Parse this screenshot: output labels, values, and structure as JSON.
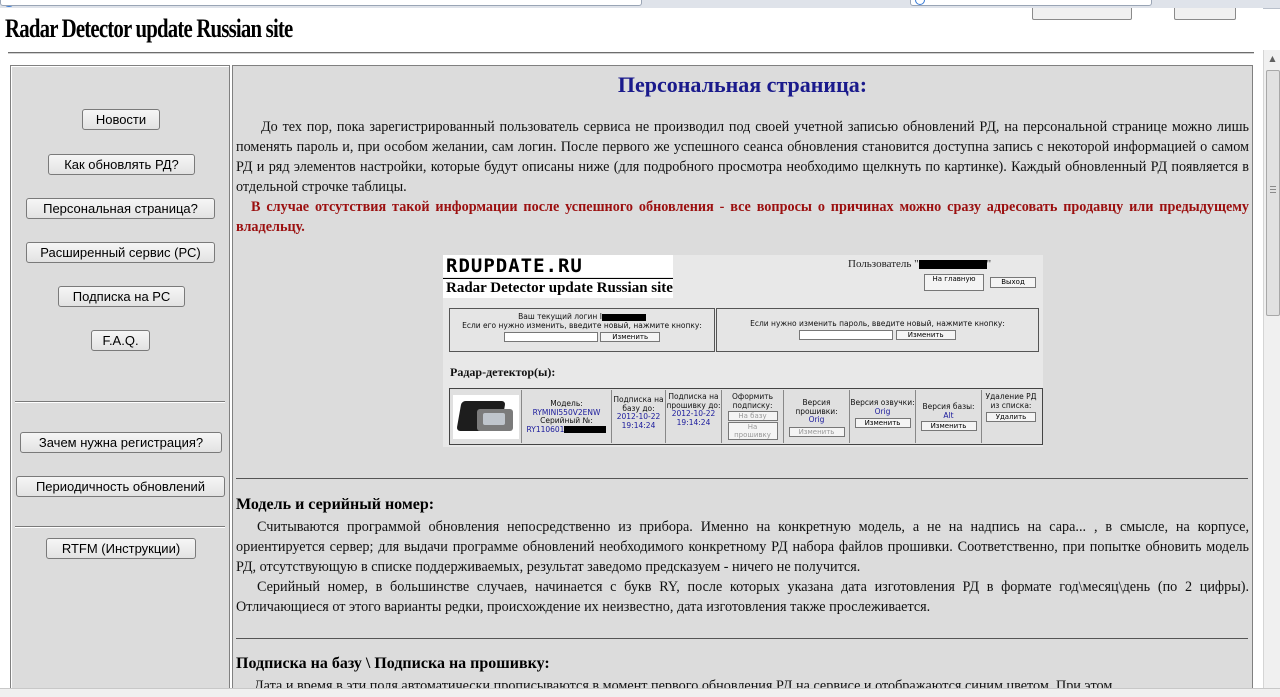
{
  "site_logo": "Radar Detector update Russian site",
  "sidebar": {
    "buttons": [
      "Новости",
      "Как обновлять РД?",
      "Персональная страница?",
      "Расширенный сервис (РС)",
      "Подписка на РС",
      "F.A.Q.",
      "Зачем нужна регистрация?",
      "Периодичность обновлений",
      "RTFM (Инструкции)"
    ]
  },
  "main": {
    "title": "Персональная страница:",
    "intro": "До тех пор, пока зарегистрированный пользователь сервиса не производил под своей учетной записью обновлений РД, на персональной странице можно лишь поменять пароль и, при особом желании, сам логин. После первого же успешного сеанса обновления становится доступна запись с некоторой информацией о самом РД и ряд элементов настройки, которые будут описаны ниже (для подробного просмотра необходимо щелкнуть по картинке). Каждый обновленный РД появляется в отдельной строчке таблицы.",
    "warning": "В случае отсутствия такой информации после успешного обновления - все вопросы о причинах можно сразу адресовать продавцу или предыдущему владельцу.",
    "screenshot": {
      "logo_top": "RDUPDATE.RU",
      "logo_bottom": "Radar Detector update Russian site",
      "user_label": "Пользователь \"",
      "user_quote_end": "\"",
      "home_button": "На главную",
      "exit_button": "Выход",
      "login_panel_line1": "Ваш текущий логин I",
      "login_panel_line2": "Если его нужно изменить, введите новый, нажмите кнопку:",
      "password_panel_text": "Если нужно изменить пароль, введите новый, нажмите кнопку:",
      "change_button": "Изменить",
      "radar_heading": "Радар-детектор(ы):",
      "model_label": "Модель:",
      "model_value": "RYMINI550V2ENW",
      "serial_label": "Серийный №:",
      "serial_value": "RY110601",
      "sub_base_label": "Подписка на базу до:",
      "sub_base_date": "2012-10-22",
      "sub_base_time": "19:14:24",
      "sub_fw_label": "Подписка на прошивку до:",
      "sub_fw_date": "2012-10-22",
      "sub_fw_time": "19:14:24",
      "subscribe_label": "Оформить подписку:",
      "on_base_button": "На базу",
      "on_fw_button": "На прошивку",
      "fw_version_label": "Версия прошивки:",
      "fw_version_value": "Orig",
      "voice_version_label": "Версия озвучки:",
      "voice_version_value": "Orig",
      "base_version_label": "Версия базы:",
      "base_version_value": "Alt",
      "delete_label": "Удаление РД из списка:",
      "delete_button": "Удалить"
    },
    "section1_title": "Модель и серийный номер:",
    "section1_p1": "Считываются программой обновления непосредственно из прибора. Именно на конкретную модель, а не на надпись на сара... , в смысле, на корпусе, ориентируется сервер; для выдачи программе обновлений необходимого конкретному РД набора файлов прошивки. Соответственно, при попытке обновить модель РД, отсутствующую в списке поддерживаемых, результат заведомо предсказуем - ничего не получится.",
    "section1_p2": "Серийный номер, в большинстве случаев, начинается с букв RY, после которых указана дата изготовления РД в формате год\\месяц\\день (по 2 цифры). Отличающиеся от этого варианты редки, происхождение их неизвестно, дата изготовления также прослеживается.",
    "section2_title": "Подписка на базу \\ Подписка на прошивку:",
    "section2_p1": "Дата и время в эти поля автоматически прописываются в момент первого обновления РД на сервисе и отображаются синим цветом. При этом"
  }
}
